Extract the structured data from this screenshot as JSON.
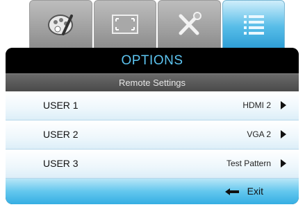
{
  "tabs": [
    {
      "name": "picture-tab",
      "icon": "palette-icon",
      "active": false
    },
    {
      "name": "display-tab",
      "icon": "screen-icon",
      "active": false
    },
    {
      "name": "setup-tab",
      "icon": "tools-icon",
      "active": false
    },
    {
      "name": "options-tab",
      "icon": "list-icon",
      "active": true
    }
  ],
  "menu": {
    "title": "OPTIONS",
    "subtitle": "Remote Settings",
    "rows": [
      {
        "label": "USER 1",
        "value": "HDMI 2"
      },
      {
        "label": "USER 2",
        "value": "VGA 2"
      },
      {
        "label": "USER 3",
        "value": "Test Pattern"
      }
    ],
    "exit_label": "Exit"
  },
  "colors": {
    "accent": "#5cc3ef",
    "footer": "#35aee3"
  }
}
